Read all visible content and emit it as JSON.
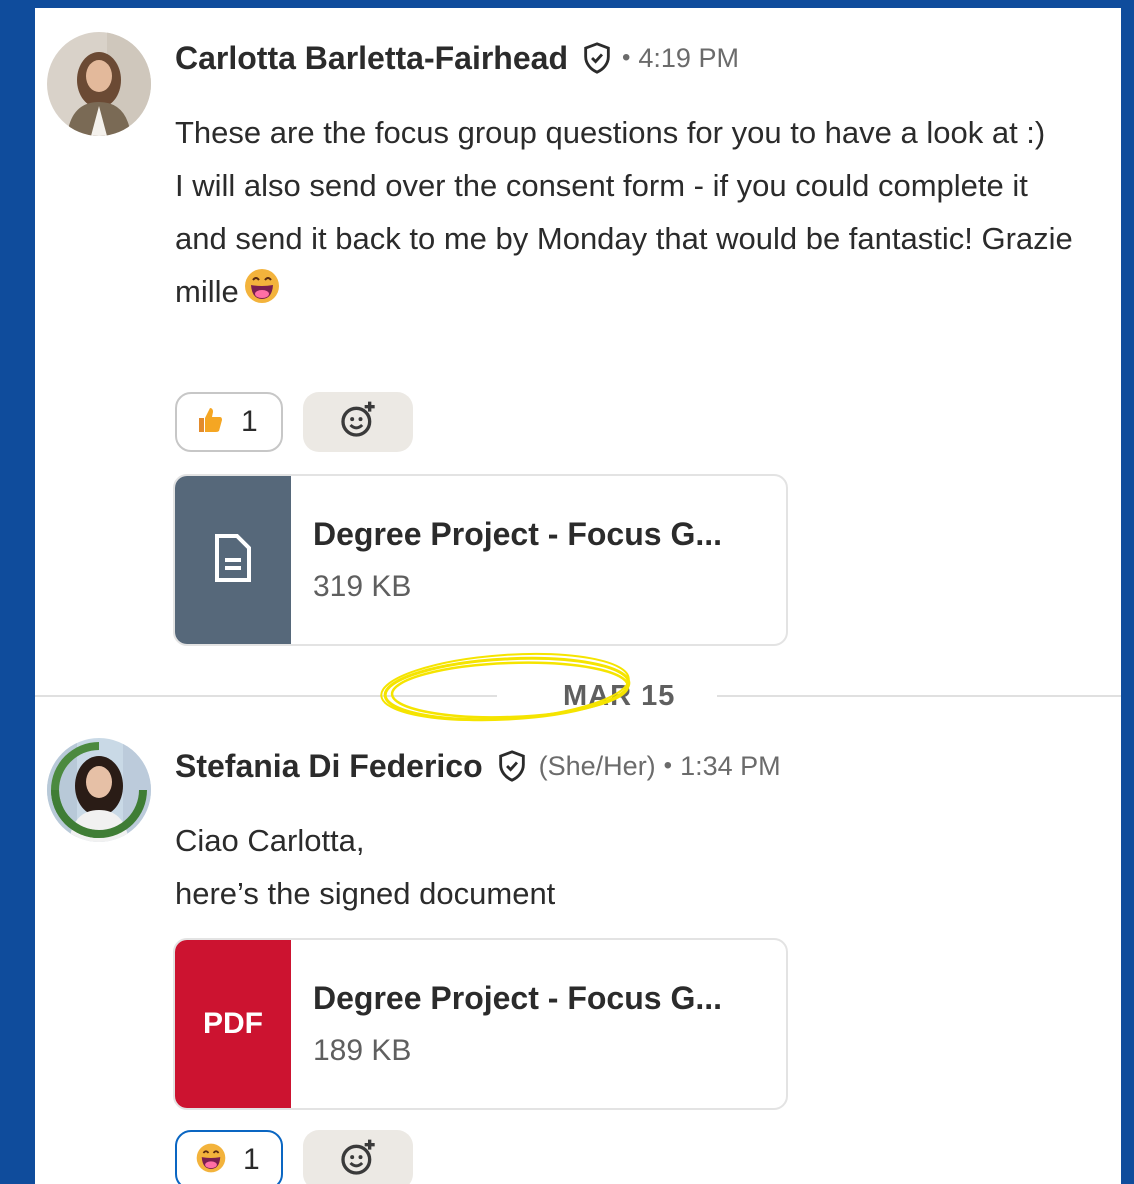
{
  "colors": {
    "frame": "#0f4c9c",
    "accent": "#0a66c2",
    "doc_thumb": "#56687a",
    "pdf_thumb": "#cc1330",
    "highlight": "#f5e400"
  },
  "messages": [
    {
      "author": "Carlotta Barletta-Fairhead",
      "verified_icon": "verified-shield-icon",
      "separator": "•",
      "time": "4:19 PM",
      "body": [
        "These are the focus group questions for you to have a look at :)",
        "I will also send over the consent form - if you could complete it and send it back to me by Monday that would be fantastic! Grazie mille"
      ],
      "reaction": {
        "emoji": "thumbs-up-emoji",
        "count": "1"
      },
      "add_reaction_icon": "add-reaction-icon",
      "attachment": {
        "type": "document",
        "name": "Degree Project - Focus G...",
        "size": "319 KB"
      }
    },
    {
      "author": "Stefania Di Federico",
      "verified_icon": "verified-shield-icon",
      "pronouns": "(She/Her)",
      "separator": "•",
      "time": "1:34 PM",
      "body": [
        "Ciao Carlotta,",
        "here’s the signed document"
      ],
      "attachment": {
        "type": "pdf",
        "thumb_label": "PDF",
        "name": "Degree Project - Focus G...",
        "size": "189 KB"
      },
      "reaction": {
        "emoji": "grinning-face-emoji",
        "count": "1"
      },
      "add_reaction_icon": "add-reaction-icon"
    }
  ],
  "date_divider": "MAR 15"
}
